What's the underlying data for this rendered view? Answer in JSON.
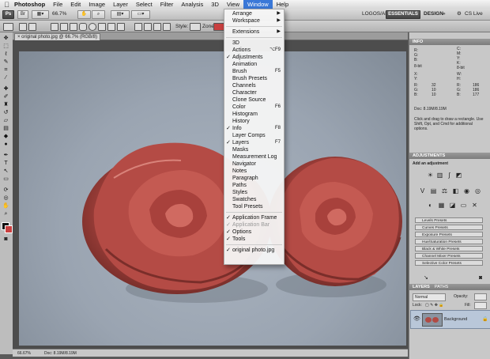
{
  "menubar": {
    "app": "Photoshop",
    "items": [
      "File",
      "Edit",
      "Image",
      "Layer",
      "Select",
      "Filter",
      "Analysis",
      "3D",
      "View",
      "Window",
      "Help"
    ],
    "active": "Window"
  },
  "appbar": {
    "logo": "Ps",
    "zoom": "66.7%",
    "workspace_left": "LOGOS/ART",
    "essentials": "ESSENTIALS",
    "design": "DESIGN",
    "more": "»",
    "cslive": "CS Live"
  },
  "optbar": {
    "style_label": "Style:",
    "style_value": "Normal",
    "zone_label": "Zone"
  },
  "document": {
    "tab_title": "original photo.jpg @ 66.7% (RGB/8)",
    "status_zoom": "66.67%",
    "status_doc": "Doc: 8.19M/8.19M"
  },
  "window_menu": {
    "items": [
      {
        "label": "Arrange",
        "arrow": "▶"
      },
      {
        "label": "Workspace",
        "arrow": "▶"
      },
      {
        "sep": true
      },
      {
        "label": "Extensions",
        "arrow": "▶"
      },
      {
        "sep": true
      },
      {
        "label": "3D"
      },
      {
        "label": "Actions",
        "shortcut": "⌥F9"
      },
      {
        "label": "Adjustments",
        "check": "✓"
      },
      {
        "label": "Animation"
      },
      {
        "label": "Brush",
        "shortcut": "F5"
      },
      {
        "label": "Brush Presets"
      },
      {
        "label": "Channels"
      },
      {
        "label": "Character"
      },
      {
        "label": "Clone Source"
      },
      {
        "label": "Color",
        "shortcut": "F6"
      },
      {
        "label": "Histogram"
      },
      {
        "label": "History"
      },
      {
        "label": "Info",
        "check": "✓",
        "shortcut": "F8"
      },
      {
        "label": "Layer Comps"
      },
      {
        "label": "Layers",
        "check": "✓",
        "shortcut": "F7"
      },
      {
        "label": "Masks"
      },
      {
        "label": "Measurement Log"
      },
      {
        "label": "Navigator"
      },
      {
        "label": "Notes"
      },
      {
        "label": "Paragraph"
      },
      {
        "label": "Paths"
      },
      {
        "label": "Styles"
      },
      {
        "label": "Swatches"
      },
      {
        "label": "Tool Presets"
      },
      {
        "sep": true
      },
      {
        "label": "Application Frame",
        "check": "✓"
      },
      {
        "label": "Application Bar",
        "check": "✓",
        "disabled": true
      },
      {
        "label": "Options",
        "check": "✓"
      },
      {
        "label": "Tools",
        "check": "✓"
      },
      {
        "sep": true
      },
      {
        "label": "original photo.jpg",
        "check": "✓"
      }
    ]
  },
  "info_panel": {
    "title": "INFO",
    "rgb": {
      "r": "R:",
      "g": "G:",
      "b": "B:"
    },
    "cmyk": {
      "c": "C:",
      "m": "M:",
      "y": "Y:",
      "k": "K:"
    },
    "bit_left": "8-bit",
    "bit_right": "8-bit",
    "xy": {
      "x": "X:",
      "y": "Y:"
    },
    "wh": {
      "w": "W:",
      "h": "H:"
    },
    "readings": {
      "r1": "R:",
      "g1": "G:",
      "b1": "B:",
      "v_r1": "32",
      "v_g1": "10",
      "v_b1": "10",
      "r2": "R:",
      "g2": "G:",
      "b2": "B:",
      "v_r2": "186",
      "v_g2": "186",
      "v_b2": "177"
    },
    "doc": "Doc: 8.19M/8.19M",
    "hint": "Click and drag to draw a rectangle.  Use Shift, Opt, and Cmd for additional options."
  },
  "adjustments_panel": {
    "title": "ADJUSTMENTS",
    "subtitle": "Add an adjustment",
    "presets": [
      "Levels Presets",
      "Curves Presets",
      "Exposure Presets",
      "Hue/Saturation Presets",
      "Black & White Presets",
      "Channel Mixer Presets",
      "Selective Color Presets"
    ]
  },
  "layers_panel": {
    "tabs": [
      "LAYERS",
      "PATHS"
    ],
    "mode": "Normal",
    "opacity_label": "Opacity:",
    "lock_label": "Lock:",
    "fill_label": "Fill:",
    "layer_name": "Background"
  },
  "colors": {
    "menu_highlight": "#3a78d8",
    "rose": "#b04a44"
  }
}
